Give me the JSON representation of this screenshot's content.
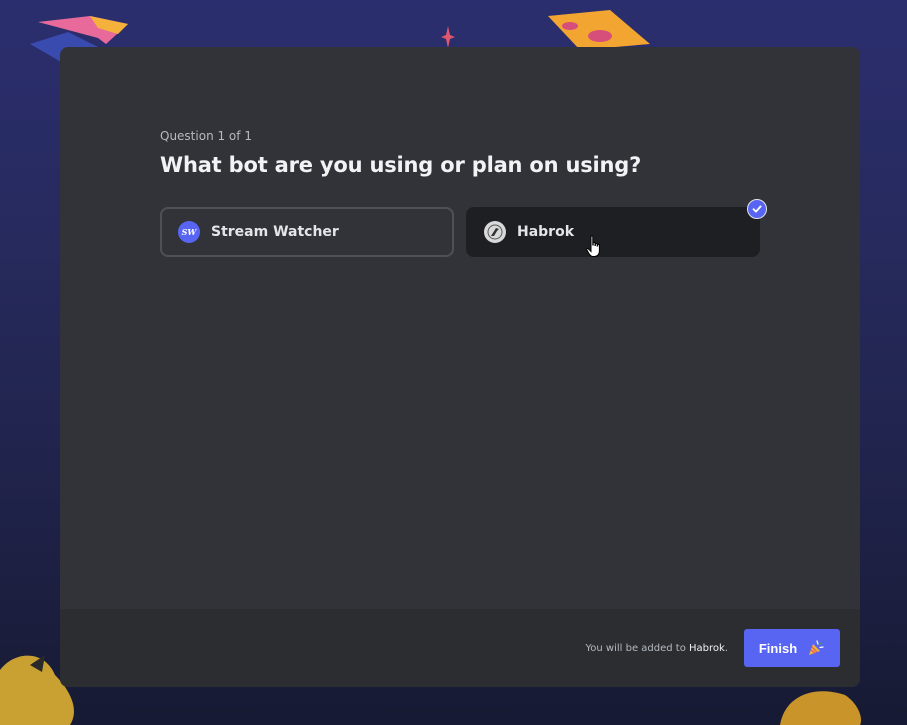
{
  "question": {
    "counter": "Question 1 of 1",
    "title": "What bot are you using or plan on using?"
  },
  "options": [
    {
      "label": "Stream Watcher",
      "avatar_text": "SW",
      "selected": false
    },
    {
      "label": "Habrok",
      "selected": true
    }
  ],
  "footer": {
    "note_prefix": "You will be added to ",
    "note_target": "Habrok",
    "note_suffix": ".",
    "finish_label": "Finish"
  },
  "colors": {
    "accent": "#5865f2",
    "modal_bg": "#313338",
    "footer_bg": "#2b2d31"
  },
  "icons": {
    "selected": "checkmark-icon",
    "finish": "party-popper-icon",
    "cursor": "hand-pointer-icon"
  }
}
